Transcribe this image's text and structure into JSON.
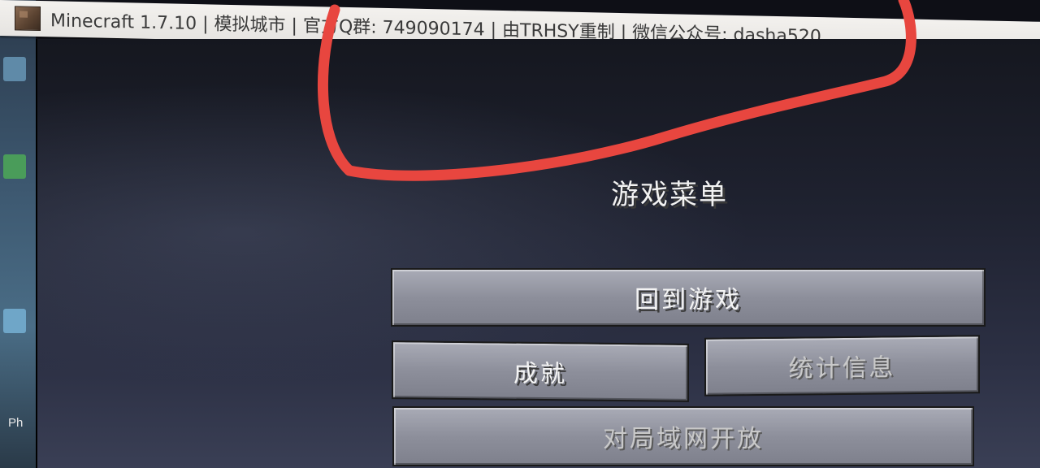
{
  "window": {
    "title": "Minecraft 1.7.10 |  模拟城市  |  官方Q群: 749090174   |  由TRHSY重制  |  微信公众号: dasha520",
    "icon": "minecraft-block-icon"
  },
  "desktop": {
    "partial_label": "Ph"
  },
  "menu": {
    "title": "游戏菜单",
    "back_to_game": "回到游戏",
    "achievements": "成就",
    "statistics": "统计信息",
    "open_to_lan": "对局域网开放"
  },
  "annotation": {
    "color": "#e8463f"
  }
}
